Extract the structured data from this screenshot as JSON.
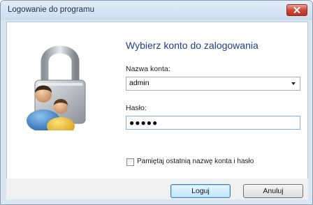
{
  "window": {
    "title": "Logowanie do programu"
  },
  "main": {
    "heading": "Wybierz konto do zalogowania",
    "account_label": "Nazwa konta:",
    "account_value": "admin",
    "password_label": "Hasło:",
    "password_value": "●●●●●",
    "remember_label": "Pamiętaj ostatnią nazwę konta i hasło",
    "remember_checked": false
  },
  "buttons": {
    "login": "Loguj",
    "cancel": "Anuluj"
  },
  "icons": {
    "close": "close-icon",
    "lock_users": "lock-users-icon"
  }
}
